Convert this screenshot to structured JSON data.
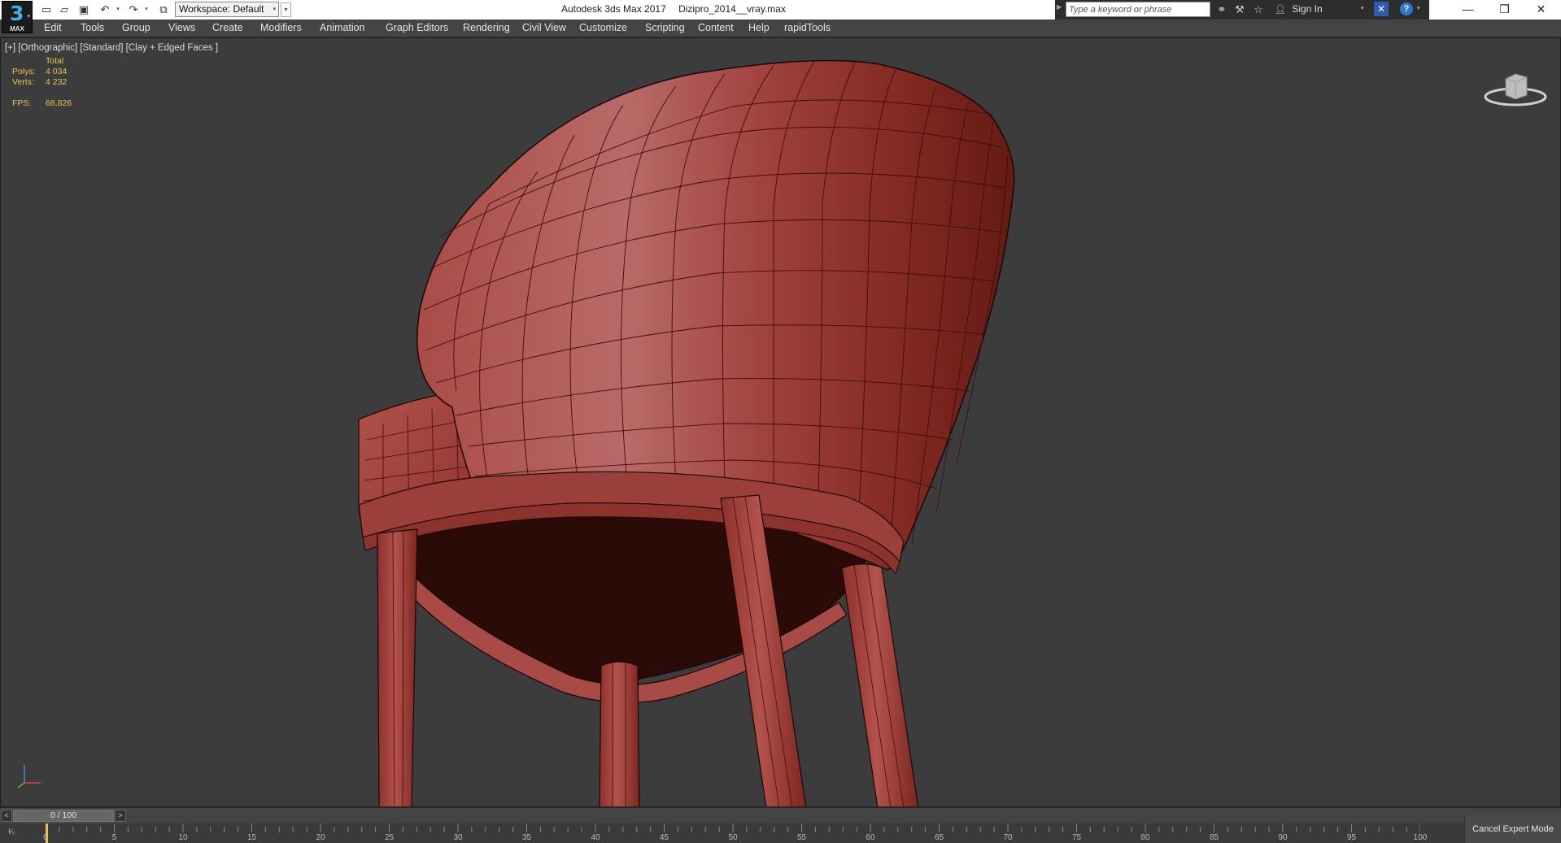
{
  "app": {
    "logo_number": "3",
    "logo_sub": "MAX",
    "title": "Autodesk 3ds Max 2017",
    "filename": "Dizipro_2014__vray.max"
  },
  "toolbar": {
    "workspace_label": "Workspace: Default"
  },
  "search": {
    "placeholder": "Type a keyword or phrase",
    "signin_label": "Sign In"
  },
  "menu": {
    "items": [
      "Edit",
      "Tools",
      "Group",
      "Views",
      "Create",
      "Modifiers",
      "Animation",
      "Graph Editors",
      "Rendering",
      "Civil View",
      "Customize",
      "Scripting",
      "Content",
      "Help",
      "rapidTools"
    ]
  },
  "viewport": {
    "label": "[+] [Orthographic] [Standard] [Clay + Edged Faces ]",
    "stats": {
      "total_label": "Total",
      "polys_label": "Polys:",
      "polys_value": "4 034",
      "verts_label": "Verts:",
      "verts_value": "4 232",
      "fps_label": "FPS:",
      "fps_value": "68,826"
    },
    "model_color": "#a54845",
    "background_color": "#3c3c3c"
  },
  "timeslider": {
    "frame_text": "0 / 100",
    "prev_label": "<",
    "next_label": ">"
  },
  "trackbar": {
    "ticks": [
      "0",
      "5",
      "10",
      "15",
      "20",
      "25",
      "30",
      "35",
      "40",
      "45",
      "50",
      "55",
      "60",
      "65",
      "70",
      "75",
      "80",
      "85",
      "90",
      "95",
      "100"
    ]
  },
  "status": {
    "expert_mode_label": "Cancel Expert Mode"
  },
  "colors": {
    "accent_yellow": "#e8c750",
    "search_bg": "#2d2d2d",
    "logo_blue": "#3ab4e8"
  }
}
